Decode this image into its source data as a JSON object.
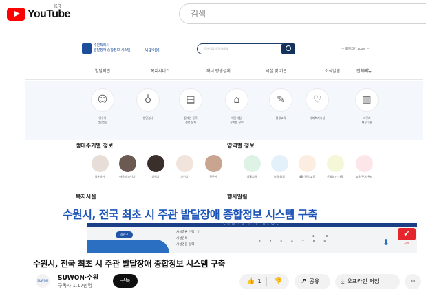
{
  "yt": {
    "logo_text": "YouTube",
    "region": "KR",
    "search_placeholder": "검색"
  },
  "site": {
    "org_name": "수원특례시\n발달장애 종합정보 시스템",
    "org_sub": "새빛이음",
    "search_placeholder": "검색어를 입력하세요",
    "zoom": "－  화면크기 100%  ＋",
    "nav": [
      "발달지면",
      "복지서비스",
      "자녀 평생설계",
      "시설 및 기관",
      "소식알림",
      "전체메뉴"
    ],
    "icons": [
      {
        "icon": "baby-face-icon",
        "glyph": "☺",
        "label": "영유아\n건강검진"
      },
      {
        "icon": "stethoscope-icon",
        "glyph": "♁",
        "label": "발달검사"
      },
      {
        "icon": "document-icon",
        "glyph": "▤",
        "label": "장애인 등록\n신청 절차"
      },
      {
        "icon": "school-icon",
        "glyph": "⌂",
        "label": "어린이집,\n유치원 정보"
      },
      {
        "icon": "education-icon",
        "glyph": "✎",
        "label": "평생교육"
      },
      {
        "icon": "heart-icon",
        "glyph": "♡",
        "label": "사회복지시설"
      },
      {
        "icon": "building-icon",
        "glyph": "▥",
        "label": "바우처\n제공기관"
      }
    ],
    "life_title": "생애주기별 정보",
    "life": [
      "영유아기",
      "아동,청소년기",
      "성인기",
      "노년기",
      "전주기"
    ],
    "area_title": "영역별 정보",
    "area": [
      "생활지원",
      "보육·돌봄",
      "재활·건강 교육",
      "문화여가·가족",
      "고용·주거·권리"
    ],
    "facility_title": "복지시설",
    "news_title": "행사알림",
    "caption": "수원시, 전국 최초 시 주관 발달장애 종합정보 시스템 구축",
    "ticker": "SUWON ITV NEWS",
    "map_chip": "장안구",
    "mini_form": "시설종류 선택   ∨\n시설검색\n시설명을 입력",
    "mini_cal": "3   4   5   6   7   8   9",
    "mini_cal2": "1   2",
    "subscribe_badge": "구독"
  },
  "colors": {
    "site_blue": "#1d4e9a",
    "caption_blue": "#1d55b8",
    "yt_red": "#ff0000",
    "badge_red": "#e5262c"
  },
  "video": {
    "title": "수원시, 전국 최초 시 주관 발달장애 종합정보 시스템 구축",
    "channel": "SUWON·수원",
    "subscribers": "구독자 1.17만명",
    "subscribe": "구독",
    "likes": "1",
    "share": "공유",
    "offline": "오프라인 저장",
    "more": "···"
  }
}
